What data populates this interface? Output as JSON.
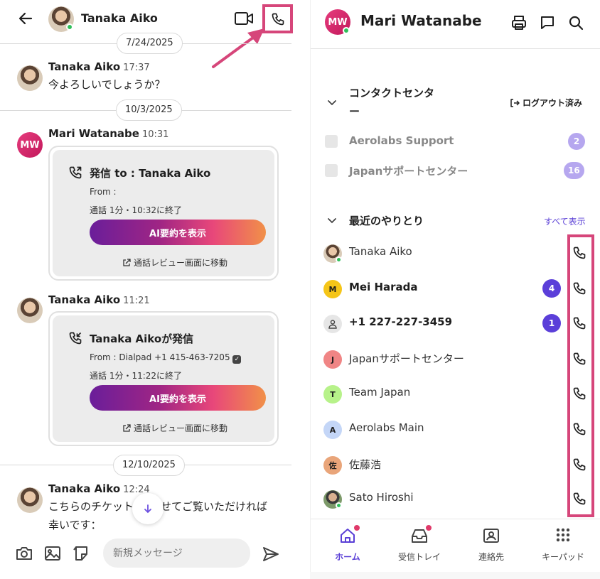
{
  "left": {
    "header": {
      "title": "Tanaka Aiko"
    },
    "dates": [
      "7/24/2025",
      "10/3/2025",
      "12/10/2025"
    ],
    "messages": [
      {
        "sender": "Tanaka Aiko",
        "time": "17:37",
        "text": "今よろしいでしょうか？"
      },
      {
        "sender": "Mari Watanabe",
        "time": "10:31",
        "initials": "MW"
      },
      {
        "sender": "Tanaka Aiko",
        "time": "11:21"
      },
      {
        "sender": "Tanaka Aiko",
        "time": "12:24",
        "text_line1": "こちらのチケット",
        "text_line1b": "せてご覧いただければ",
        "text_line2": "幸いです："
      }
    ],
    "call_cards": [
      {
        "title": "発信 to : Tanaka Aiko",
        "from": "From :",
        "duration": "通話 1分・10:32に終了",
        "ai_button": "AI要約を表示",
        "review_link": "通話レビュー画面に移動"
      },
      {
        "title": "Tanaka Aikoが発信",
        "from": "From : Dialpad +1 415-463-7205",
        "duration": "通話 1分・11:22に終了",
        "ai_button": "AI要約を表示",
        "review_link": "通話レビュー画面に移動"
      }
    ],
    "composer": {
      "placeholder": "新規メッセージ"
    }
  },
  "right": {
    "header": {
      "title": "Mari Watanabe",
      "initials": "MW"
    },
    "contact_center": {
      "title_line1": "コンタクトセンタ",
      "title_line2": "ー",
      "status": "ログアウト済み",
      "queues": [
        {
          "name": "Aerolabs Support",
          "count": "2"
        },
        {
          "name": "Japanサポートセンター",
          "count": "16"
        }
      ]
    },
    "recent": {
      "title": "最近のやりとり",
      "show_all": "すべて表示",
      "contacts": [
        {
          "name": "Tanaka Aiko",
          "initial": "",
          "bold": false,
          "badge": ""
        },
        {
          "name": "Mei Harada",
          "initial": "M",
          "bold": true,
          "badge": "4",
          "color": "#f5c518"
        },
        {
          "name": "+1 227-227-3459",
          "initial": "",
          "bold": true,
          "badge": "1",
          "color": "#e6e6e6"
        },
        {
          "name": "Japanサポートセンター",
          "initial": "J",
          "bold": false,
          "badge": "",
          "color": "#f08585"
        },
        {
          "name": "Team Japan",
          "initial": "T",
          "bold": false,
          "badge": "",
          "color": "#b7f28a"
        },
        {
          "name": "Aerolabs Main",
          "initial": "A",
          "bold": false,
          "badge": "",
          "color": "#c4d6f7"
        },
        {
          "name": "佐藤浩",
          "initial": "佐",
          "bold": false,
          "badge": "",
          "color": "#e9a57a"
        },
        {
          "name": "Sato Hiroshi",
          "initial": "",
          "bold": false,
          "badge": ""
        }
      ]
    },
    "tabs": [
      {
        "label": "ホーム",
        "active": true,
        "dot": true
      },
      {
        "label": "受信トレイ",
        "active": false,
        "dot": true
      },
      {
        "label": "連絡先",
        "active": false,
        "dot": false
      },
      {
        "label": "キーパッド",
        "active": false,
        "dot": false
      }
    ]
  },
  "colors": {
    "accent": "#5a3fd6",
    "highlight": "#d6467a",
    "brand": "#c2185b",
    "online": "#2fbf5a"
  }
}
